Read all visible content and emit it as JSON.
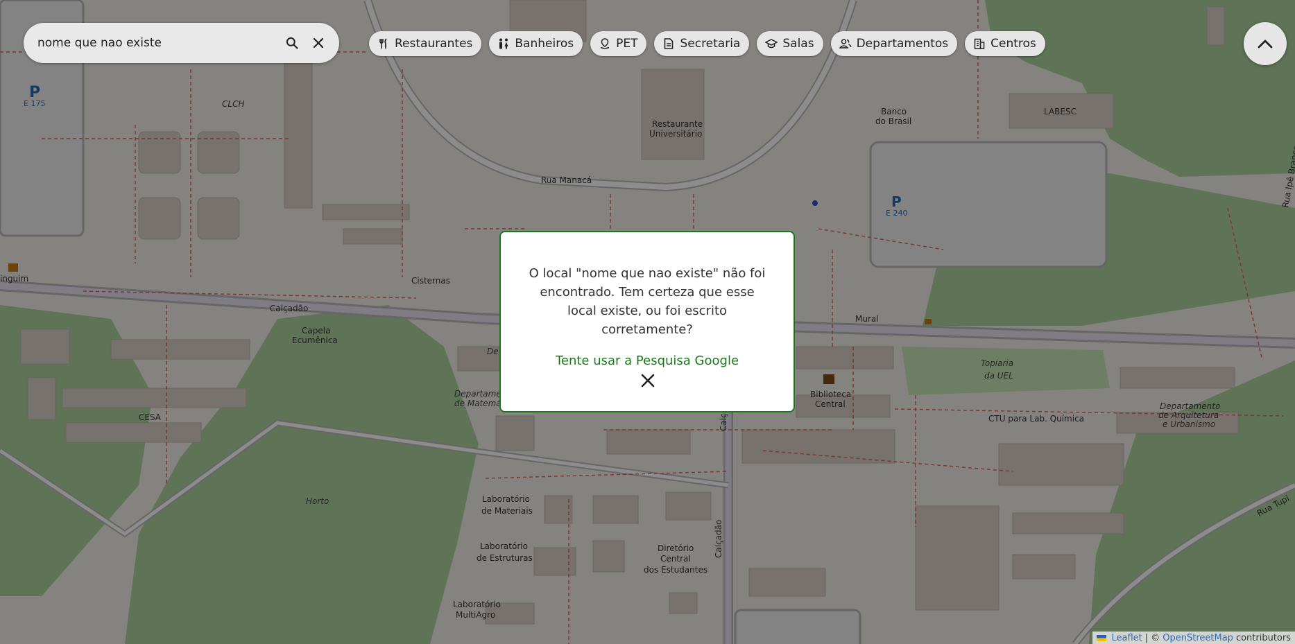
{
  "search": {
    "value": "nome que nao existe",
    "placeholder": ""
  },
  "chips": [
    {
      "label": "Restaurantes",
      "icon": "fork-knife-icon"
    },
    {
      "label": "Banheiros",
      "icon": "restroom-icon"
    },
    {
      "label": "PET",
      "icon": "pet-pin-icon"
    },
    {
      "label": "Secretaria",
      "icon": "document-icon"
    },
    {
      "label": "Salas",
      "icon": "graduation-cap-icon"
    },
    {
      "label": "Departamentos",
      "icon": "people-icon"
    },
    {
      "label": "Centros",
      "icon": "building-icon"
    }
  ],
  "modal": {
    "message": "O local \"nome que nao existe\" não foi encontrado. Tem certeza que esse local existe, ou foi escrito corretamente?",
    "link": "Tente usar a Pesquisa Google"
  },
  "map_labels": {
    "clch": "CLCH",
    "e175": "E 175",
    "e240": "E 240",
    "restaurante1": "Restaurante",
    "restaurante2": "Universitário",
    "rua_manaca": "Rua Manacá",
    "banco1": "Banco",
    "banco2": "do Brasil",
    "labesc": "LABESC",
    "rua_ipe": "Rua Ipê Branco",
    "cisternas": "Cisternas",
    "calcadao": "Calçadão",
    "calcadao2": "Calçadão",
    "calcadao3": "Calç",
    "capela1": "Capela",
    "capela2": "Ecumênica",
    "cesa": "CESA",
    "mural": "Mural",
    "biblioteca1": "Biblioteca",
    "biblioteca2": "Central",
    "topiaria1": "Topiaria",
    "topiaria2": "da UEL",
    "ctu": "CTU para Lab. Química",
    "dep_arq1": "Departamento",
    "dep_arq2": "de Arquitetura",
    "dep_arq3": "e Urbanismo",
    "dep_mat1": "Departame",
    "dep_mat2": "de Matemá",
    "horto": "Horto",
    "lab_mat1": "Laboratório",
    "lab_mat2": "de Materiais",
    "lab_est1": "Laboratório",
    "lab_est2": "de Estruturas",
    "dce1": "Diretório",
    "dce2": "Central",
    "dce3": "dos Estudantes",
    "lab_multi1": "Laboratório",
    "lab_multi2": "MultiAgro",
    "rua_tupi": "Rua Tupi",
    "guim": "inguim",
    "de": "De"
  },
  "attribution": {
    "leaflet": "Leaflet",
    "sep": "| ©",
    "osm": "OpenStreetMap",
    "contributors": "contributors"
  },
  "colors": {
    "accent": "#1a7a1a",
    "background": "#f2efe9",
    "building": "#d9d0c9",
    "park": "#add19e"
  }
}
